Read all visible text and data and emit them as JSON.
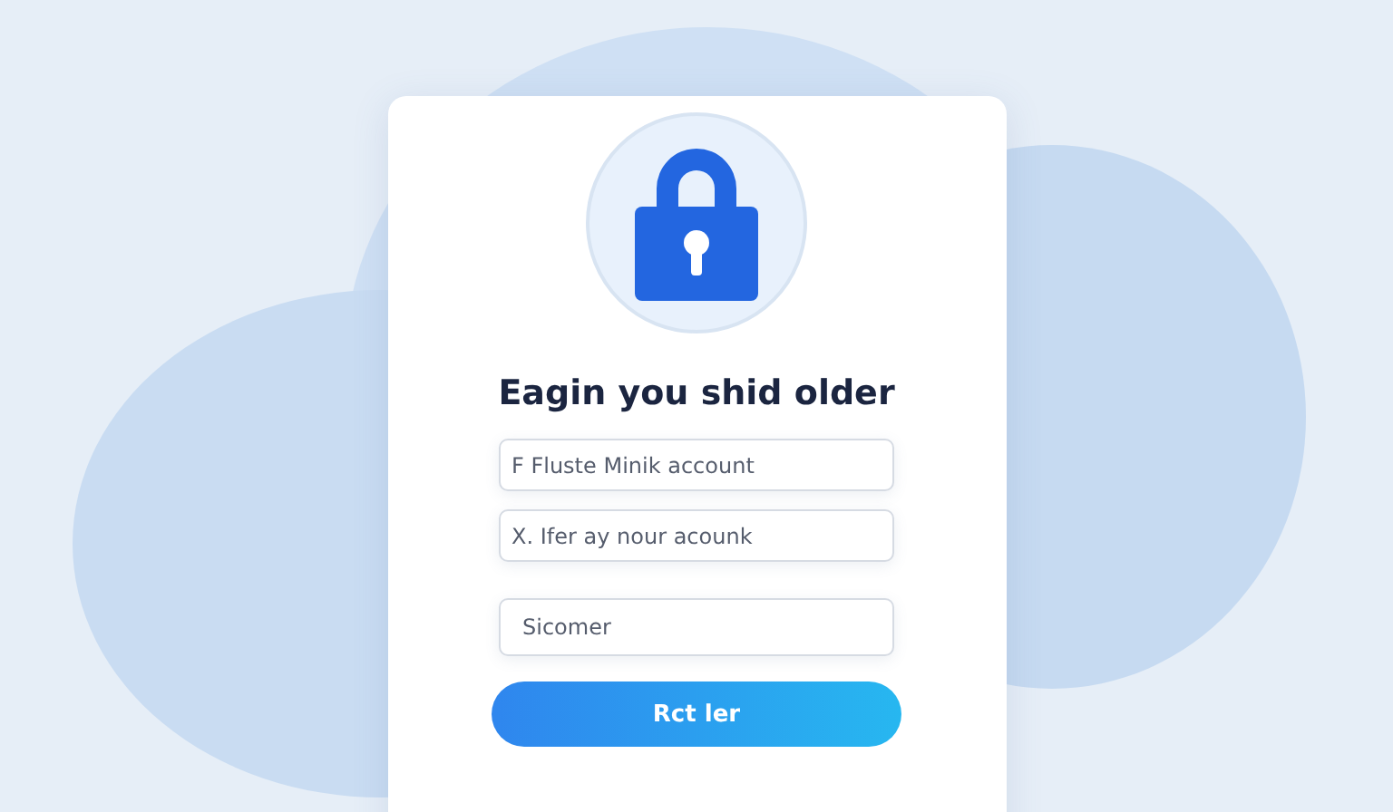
{
  "login_card": {
    "title": "Eagin you shid older",
    "fields": [
      {
        "placeholder": "F Fluste Minik account"
      },
      {
        "placeholder": "X. Ifer ay nour acounk"
      },
      {
        "placeholder": "Sicomer"
      }
    ],
    "button": "Rct ler"
  }
}
